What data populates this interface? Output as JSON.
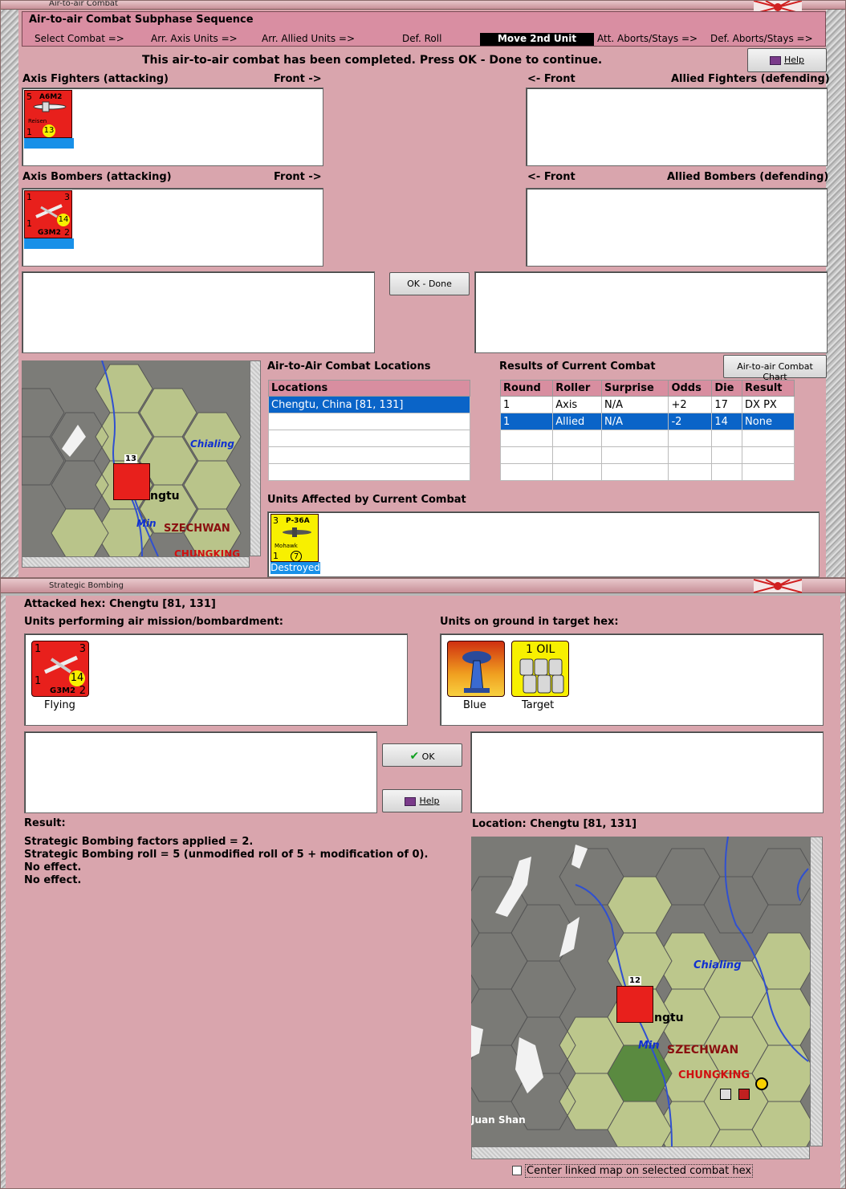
{
  "air_window": {
    "title": "Air-to-air Combat",
    "sequence_title": "Air-to-air Combat Subphase Sequence",
    "steps": [
      "Select Combat =>",
      "Arr. Axis Units =>",
      "Arr. Allied Units =>",
      "Def. Roll",
      "Move 2nd Unit",
      "Att. Aborts/Stays =>",
      "Def. Aborts/Stays =>"
    ],
    "active_step": "Move 2nd Unit",
    "message": "This air-to-air combat has been completed.  Press OK - Done to continue.",
    "help_label": "Help",
    "axis_fighters_label": "Axis Fighters (attacking)",
    "front_right": "Front ->",
    "front_left": "<- Front",
    "allied_fighters_label": "Allied Fighters (defending)",
    "axis_bombers_label": "Axis Bombers (attacking)",
    "allied_bombers_label": "Allied Bombers (defending)",
    "ok_done_label": "OK - Done",
    "fighter_unit": {
      "top_left": "5",
      "name": "A6M2",
      "sub": "Reisen",
      "bottom_left": "1",
      "circle": "13"
    },
    "bomber_unit": {
      "top_left": "1",
      "top_right": "3",
      "circle": "14",
      "bottom_left": "1",
      "name": "G3M2",
      "bottom_right": "2"
    },
    "locations_title": "Air-to-Air Combat Locations",
    "locations_header": "Locations",
    "locations": [
      "Chengtu, China [81, 131]"
    ],
    "results_title": "Results of Current Combat",
    "chart_button": "Air-to-air Combat Chart",
    "results_headers": [
      "Round",
      "Roller",
      "Surprise",
      "Odds",
      "Die",
      "Result"
    ],
    "results_rows": [
      [
        "1",
        "Axis",
        "N/A",
        "+2",
        "17",
        "DX PX"
      ],
      [
        "1",
        "Allied",
        "N/A",
        "-2",
        "14",
        "None"
      ]
    ],
    "affected_title": "Units Affected by Current Combat",
    "affected_unit": {
      "top_left": "3",
      "name": "P-36A",
      "sub": "Mohawk",
      "bottom_left": "1",
      "circle": "7",
      "status": "Destroyed"
    },
    "map_labels": {
      "chialing": "Chialing",
      "chengtu": "ngtu",
      "min": "Min",
      "szechwan": "SZECHWAN",
      "chungking": "CHUNGKING",
      "stack": "13"
    }
  },
  "bomb_window": {
    "title": "Strategic Bombing",
    "attacked_hex": "Attacked hex: Chengtu  [81, 131]",
    "performing_label": "Units performing air mission/bombardment:",
    "ground_label": "Units on ground in target hex:",
    "bomber_status": "Flying",
    "ground_units": [
      {
        "label": "Blue"
      },
      {
        "label": "Target",
        "text": "1 OIL"
      }
    ],
    "ok_label": "OK",
    "help_label": "Help",
    "result_label": "Result:",
    "result_lines": [
      "Strategic Bombing factors applied = 2.",
      "Strategic Bombing roll = 5 (unmodified roll of 5 + modification of 0).",
      "No effect.",
      "No effect."
    ],
    "location_label": "Location:  Chengtu  [81, 131]",
    "center_checkbox": "Center linked map on selected combat hex",
    "center_checked": false,
    "map_labels": {
      "chialing": "Chialing",
      "chengtu": "ngtu",
      "min": "Min",
      "szechwan": "SZECHWAN",
      "chungking": "CHUNGKING",
      "juan_shan": "Juan Shan",
      "stack": "12"
    }
  },
  "colors": {
    "window_bg": "#d9a5ad",
    "header_pink": "#d88ea0",
    "selection_blue": "#0a64c8",
    "unit_red": "#e8201c",
    "unit_yellow": "#f8f000"
  }
}
